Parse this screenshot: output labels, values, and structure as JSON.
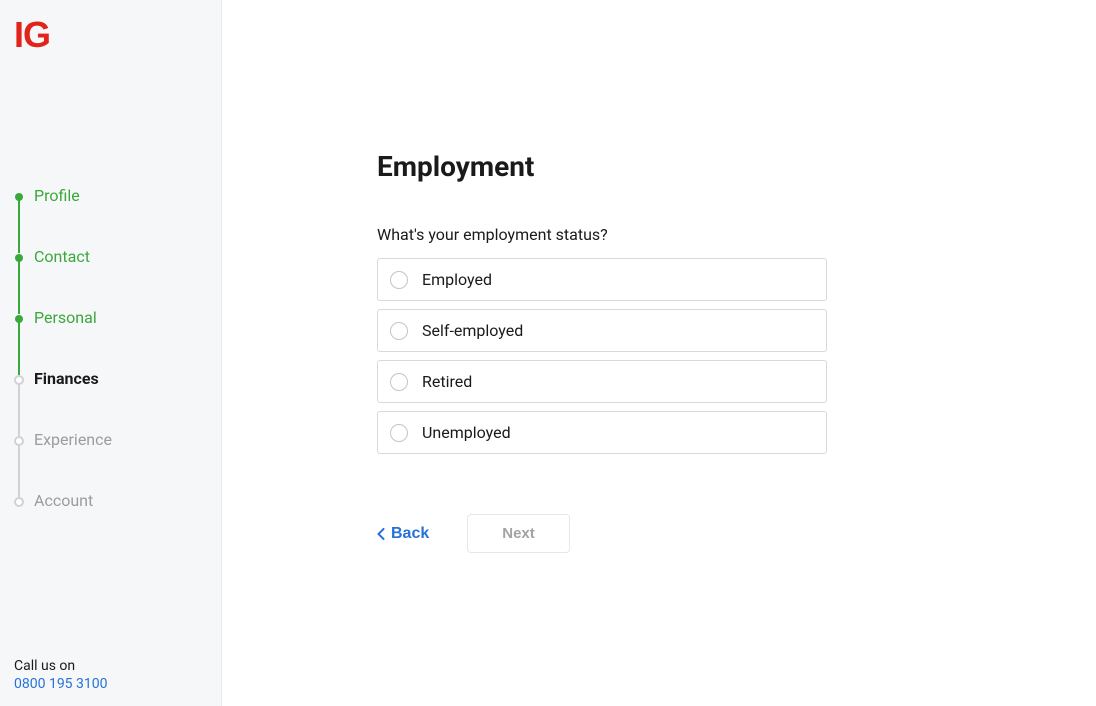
{
  "logo": "IG",
  "sidebar": {
    "steps": [
      {
        "label": "Profile",
        "status": "completed"
      },
      {
        "label": "Contact",
        "status": "completed"
      },
      {
        "label": "Personal",
        "status": "completed"
      },
      {
        "label": "Finances",
        "status": "current"
      },
      {
        "label": "Experience",
        "status": "upcoming"
      },
      {
        "label": "Account",
        "status": "upcoming"
      }
    ],
    "footer": {
      "label": "Call us on",
      "phone": "0800 195 3100"
    }
  },
  "main": {
    "heading": "Employment",
    "question": "What's your employment status?",
    "options": [
      "Employed",
      "Self-employed",
      "Retired",
      "Unemployed"
    ],
    "back_label": "Back",
    "next_label": "Next"
  }
}
